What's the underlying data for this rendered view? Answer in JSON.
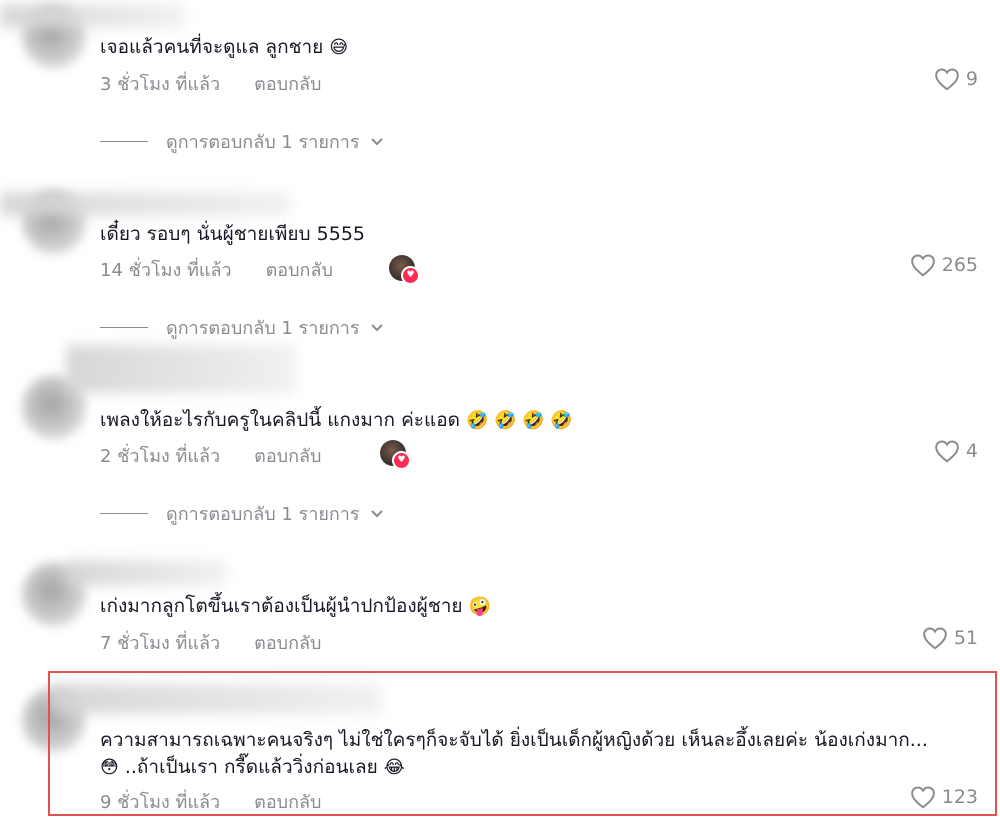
{
  "comments": [
    {
      "text": "เจอแล้วคนที่จะดูแล ลูกชาย",
      "emoji": "😅",
      "time": "3 ชั่วโมง ที่แล้ว",
      "reply": "ตอบกลับ",
      "likes": "9",
      "view_replies": "ดูการตอบกลับ 1 รายการ",
      "creator_liked": false
    },
    {
      "text": "เดี๋ยว รอบๆ นั่นผู้ชายเพียบ 5555",
      "emoji": "",
      "time": "14 ชั่วโมง ที่แล้ว",
      "reply": "ตอบกลับ",
      "likes": "265",
      "view_replies": "ดูการตอบกลับ 1 รายการ",
      "creator_liked": true
    },
    {
      "text": "เพลงให้อะไรกับครูในคลิปนี้ แกงมาก ค่ะแอด",
      "emoji": "🤣 🤣 🤣 🤣",
      "time": "2 ชั่วโมง ที่แล้ว",
      "reply": "ตอบกลับ",
      "likes": "4",
      "view_replies": "ดูการตอบกลับ 1 รายการ",
      "creator_liked": true
    },
    {
      "text": "เก่งมากลูกโตขึ้นเราต้องเป็นผู้นำปกป้องผู้ชาย",
      "emoji": "🤪",
      "time": "7 ชั่วโมง ที่แล้ว",
      "reply": "ตอบกลับ",
      "likes": "51",
      "creator_liked": false
    },
    {
      "text": "ความสามารถเฉพาะคนจริงๆ ไม่ใช่ใครๆก็จะจับได้ ยิ่งเป็นเด็กผู้หญิงด้วย เห็นละอึ้งเลยค่ะ น้องเก่งมาก...",
      "text2": "..ถ้าเป็นเรา กรี๊ดแล้ววิ่งก่อนเลย",
      "emoji_lead": "😳",
      "emoji": "😂",
      "time": "9 ชั่วโมง ที่แล้ว",
      "reply": "ตอบกลับ",
      "likes": "123",
      "creator_liked": false,
      "highlighted": true
    }
  ],
  "colors": {
    "text": "#161823",
    "muted": "#8a8b91",
    "highlight_border": "#e05252",
    "creator_heart": "#fe2c55"
  },
  "icons": {
    "like": "heart-outline-icon",
    "expand": "chevron-down-icon"
  }
}
